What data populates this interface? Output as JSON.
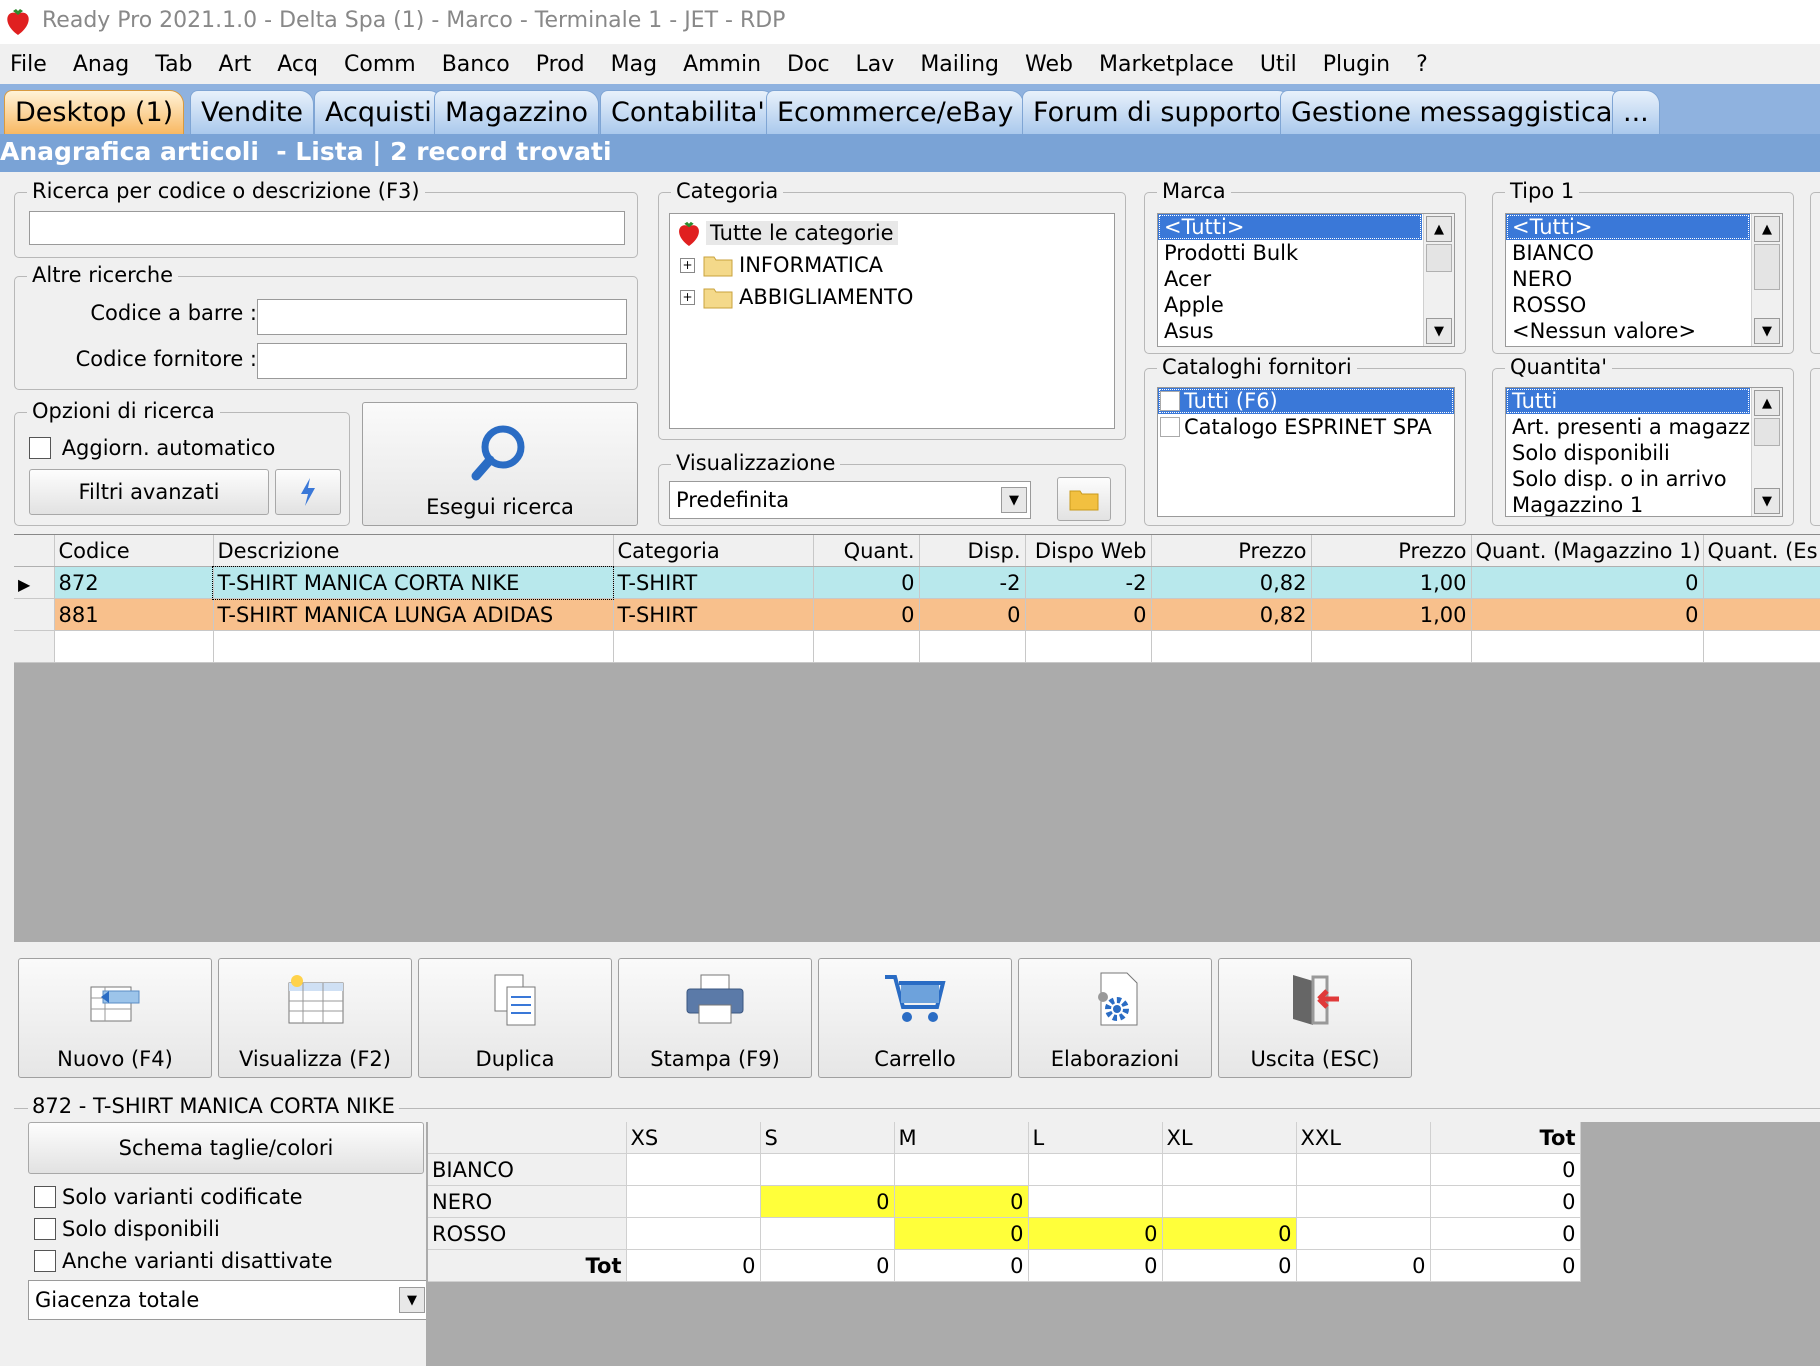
{
  "window": {
    "title": "Ready Pro 2021.1.0 - Delta Spa (1) - Marco - Terminale 1 - JET - RDP"
  },
  "menu": [
    "File",
    "Anag",
    "Tab",
    "Art",
    "Acq",
    "Comm",
    "Banco",
    "Prod",
    "Mag",
    "Ammin",
    "Doc",
    "Lav",
    "Mailing",
    "Web",
    "Marketplace",
    "Util",
    "Plugin",
    "?"
  ],
  "tabs": [
    "Desktop (1)",
    "Vendite",
    "Acquisti",
    "Magazzino",
    "Contabilita'",
    "Ecommerce/eBay",
    "Forum di supporto",
    "Gestione messaggistica",
    "..."
  ],
  "header": {
    "title": "Anagrafica articoli  - Lista | 2 record trovati"
  },
  "search": {
    "label": "Ricerca per codice o descrizione (F3)",
    "value": ""
  },
  "other": {
    "label": "Altre ricerche",
    "barcode_label": "Codice a barre :",
    "barcode_value": "",
    "supplier_label": "Codice fornitore :",
    "supplier_value": ""
  },
  "options": {
    "label": "Opzioni di ricerca",
    "auto_update": "Aggiorn. automatico",
    "advanced": "Filtri avanzati",
    "run_search": "Esegui ricerca"
  },
  "category": {
    "label": "Categoria",
    "items": [
      "Tutte le categorie",
      "INFORMATICA",
      "ABBIGLIAMENTO"
    ]
  },
  "view": {
    "label": "Visualizzazione",
    "value": "Predefinita"
  },
  "brand": {
    "label": "Marca",
    "items": [
      "<Tutti>",
      "Prodotti Bulk",
      "Acer",
      "Apple",
      "Asus"
    ]
  },
  "supplier_catalogs": {
    "label": "Cataloghi fornitori",
    "items": [
      "Tutti (F6)",
      "Catalogo ESPRINET SPA"
    ]
  },
  "type1": {
    "label": "Tipo 1",
    "items": [
      "<Tutti>",
      "BIANCO",
      "NERO",
      "ROSSO",
      "<Nessun valore>"
    ]
  },
  "quantity": {
    "label": "Quantita'",
    "items": [
      "Tutti",
      "Art. presenti a magazzino",
      "Solo disponibili",
      "Solo disp. o in arrivo",
      "Magazzino 1"
    ]
  },
  "table": {
    "columns": [
      "Codice",
      "Descrizione",
      "Categoria",
      "Quant.",
      "Disp.",
      "Dispo Web",
      "Prezzo",
      "Prezzo",
      "Quant. (Magazzino 1)",
      "Quant. (Es"
    ],
    "rows": [
      [
        "872",
        "T-SHIRT MANICA CORTA NIKE",
        "T-SHIRT",
        "0",
        "-2",
        "-2",
        "0,82",
        "1,00",
        "0",
        ""
      ],
      [
        "881",
        "T-SHIRT MANICA LUNGA ADIDAS",
        "T-SHIRT",
        "0",
        "0",
        "0",
        "0,82",
        "1,00",
        "0",
        ""
      ]
    ]
  },
  "actions": [
    "Nuovo (F4)",
    "Visualizza (F2)",
    "Duplica",
    "Stampa (F9)",
    "Carrello",
    "Elaborazioni",
    "Uscita (ESC)"
  ],
  "variants": {
    "label": "872 - T-SHIRT MANICA CORTA NIKE",
    "scheme_button": "Schema taglie/colori",
    "only_coded": "Solo varianti codificate",
    "only_available": "Solo disponibili",
    "include_disabled": "Anche varianti disattivate",
    "stock_select": "Giacenza totale",
    "sizes": [
      "XS",
      "S",
      "M",
      "L",
      "XL",
      "XXL",
      "Tot"
    ],
    "rows": [
      {
        "color": "BIANCO",
        "cells": [
          "",
          "",
          "",
          "",
          "",
          "",
          "0"
        ]
      },
      {
        "color": "NERO",
        "cells": [
          "",
          "0",
          "0",
          "",
          "",
          "",
          "0"
        ]
      },
      {
        "color": "ROSSO",
        "cells": [
          "",
          "",
          "0",
          "0",
          "0",
          "",
          "0"
        ]
      }
    ],
    "total_label": "Tot",
    "totals": [
      "0",
      "0",
      "0",
      "0",
      "0",
      "0",
      "0"
    ]
  },
  "colors": {
    "accent_blue": "#3a78d8",
    "row_selected": "#b8e8ec",
    "row_orange": "#f8c08c",
    "yellow": "#ffff3a"
  }
}
